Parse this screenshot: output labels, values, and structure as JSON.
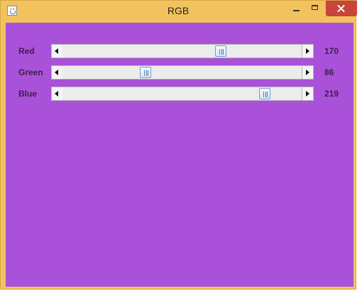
{
  "window": {
    "title": "RGB",
    "icon": "java-cup-icon",
    "controls": [
      "minimize-icon",
      "maximize-icon",
      "close-icon"
    ]
  },
  "content": {
    "background_color": "#a952d9"
  },
  "sliders": [
    {
      "label": "Red",
      "value": "170",
      "min": 0,
      "max": 255
    },
    {
      "label": "Green",
      "value": "86",
      "min": 0,
      "max": 255
    },
    {
      "label": "Blue",
      "value": "219",
      "min": 0,
      "max": 255
    }
  ]
}
